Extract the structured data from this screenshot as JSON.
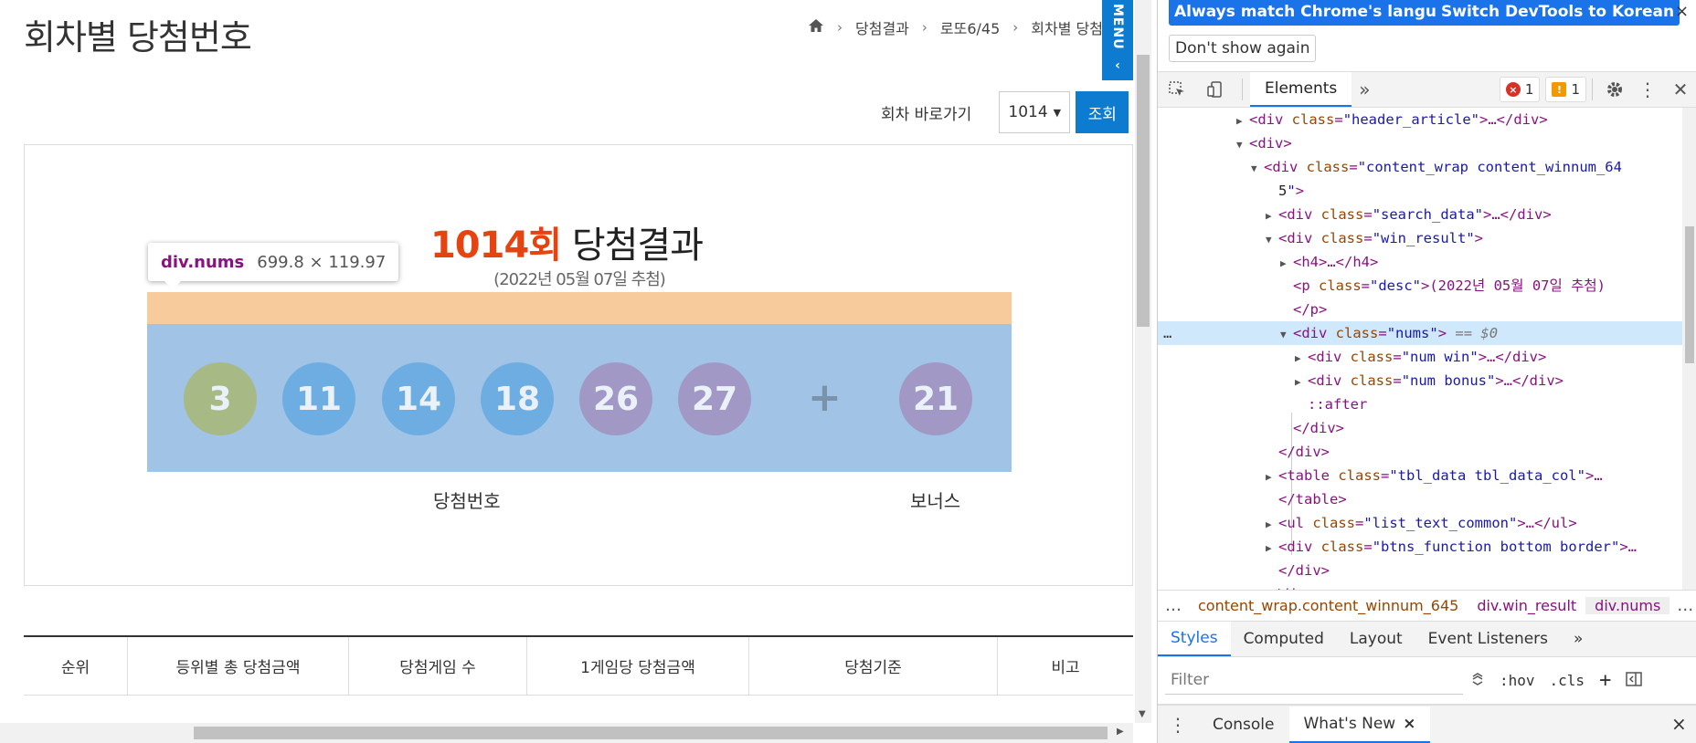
{
  "page": {
    "title": "회차별 당첨번호",
    "breadcrumb": [
      "당첨결과",
      "로또6/45",
      "회차별 당첨"
    ],
    "menu_tab": "MENU",
    "round_nav_label": "회차 바로가기",
    "round_selected": "1014",
    "round_go_button": "조회",
    "result_round": "1014회",
    "result_title_suffix": "당첨결과",
    "result_desc": "(2022년 05월 07일 추첨)",
    "tooltip_selector": "div.nums",
    "tooltip_size": "699.8 × 119.97",
    "winning_numbers": [
      "3",
      "11",
      "14",
      "18",
      "26",
      "27"
    ],
    "bonus_number": "21",
    "plus": "+",
    "label_win": "당첨번호",
    "label_bonus": "보너스",
    "table_headers": [
      "순위",
      "등위별 총 당첨금액",
      "당첨게임 수",
      "1게임당 당첨금액",
      "당첨기준",
      "비고"
    ],
    "colors": {
      "ball_yellow": "#a9b76a",
      "ball_blue": "#5fa8e0",
      "ball_purple": "#a28cbd",
      "accent": "#0c7bd0",
      "round_red": "#e64310"
    }
  },
  "devtools": {
    "lang_buttons": [
      "Always match Chrome's language",
      "Switch DevTools to Korean",
      "Don't show again"
    ],
    "lang_close": "×",
    "tab_elements": "Elements",
    "more_tabs": "»",
    "error_count": "1",
    "warning_count": "1",
    "dom": [
      {
        "indent": 5,
        "tri": "▶",
        "html": "<div class=\"header_article\">…</div>"
      },
      {
        "indent": 5,
        "tri": "▼",
        "html": "<div>"
      },
      {
        "indent": 6,
        "tri": "▼",
        "html": "<div class=\"content_wrap content_winnum_64"
      },
      {
        "indent": 7,
        "tri": "",
        "html": "5\">"
      },
      {
        "indent": 7,
        "tri": "▶",
        "html": "<div class=\"search_data\">…</div>"
      },
      {
        "indent": 7,
        "tri": "▼",
        "html": "<div class=\"win_result\">"
      },
      {
        "indent": 8,
        "tri": "▶",
        "html": "<h4>…</h4>"
      },
      {
        "indent": 8,
        "tri": "",
        "html": "<p class=\"desc\">(2022년 05월 07일 추첨)"
      },
      {
        "indent": 8,
        "tri": "",
        "html": "</p>"
      },
      {
        "indent": 8,
        "tri": "▼",
        "html": "<div class=\"nums\">",
        "selected": true,
        "suffix": "== $0"
      },
      {
        "indent": 9,
        "tri": "▶",
        "html": "<div class=\"num win\">…</div>"
      },
      {
        "indent": 9,
        "tri": "▶",
        "html": "<div class=\"num bonus\">…</div>"
      },
      {
        "indent": 9,
        "tri": "",
        "html": "::after"
      },
      {
        "indent": 8,
        "tri": "",
        "html": "</div>"
      },
      {
        "indent": 7,
        "tri": "",
        "html": "</div>"
      },
      {
        "indent": 7,
        "tri": "▶",
        "html": "<table class=\"tbl_data tbl_data_col\">…"
      },
      {
        "indent": 7,
        "tri": "",
        "html": "</table>"
      },
      {
        "indent": 7,
        "tri": "▶",
        "html": "<ul class=\"list_text_common\">…</ul>"
      },
      {
        "indent": 7,
        "tri": "▶",
        "html": "<div class=\"btns_function bottom border\">…"
      },
      {
        "indent": 7,
        "tri": "",
        "html": "</div>"
      },
      {
        "indent": 6,
        "tri": "",
        "html": "</div>"
      }
    ],
    "breadcrumb": [
      "…",
      "content_wrap.content_winnum_645",
      "div.win_result",
      "div.nums",
      "…"
    ],
    "styles_tabs": [
      "Styles",
      "Computed",
      "Layout",
      "Event Listeners",
      "»"
    ],
    "filter_placeholder": "Filter",
    "filter_buttons": [
      ":hov",
      ".cls",
      "+"
    ],
    "drawer_tabs": [
      "Console",
      "What's New"
    ],
    "drawer_close_tab": "×",
    "drawer_close": "×"
  }
}
